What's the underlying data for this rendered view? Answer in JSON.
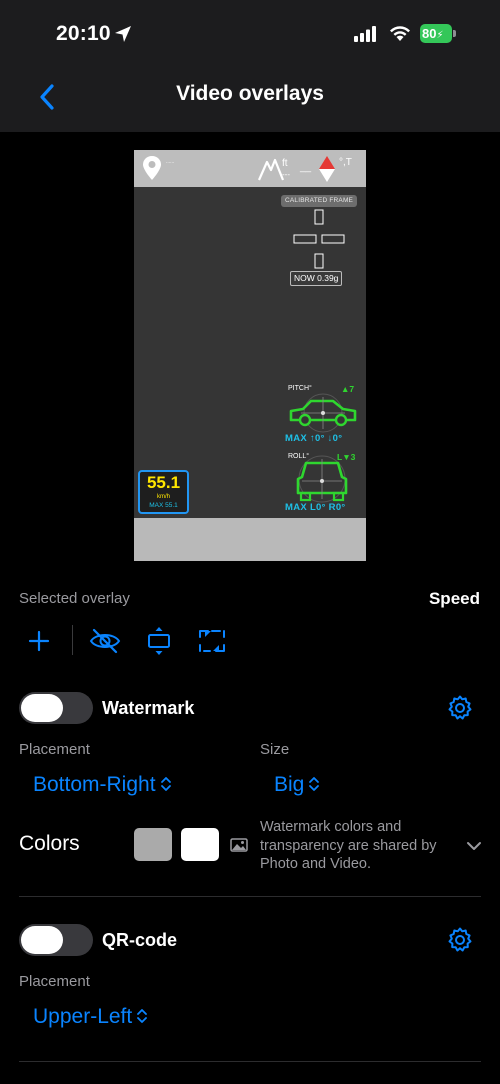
{
  "status_bar": {
    "time": "20:10",
    "battery": "80",
    "icons": [
      "location-arrow-icon",
      "cellular-signal-icon",
      "wifi-icon",
      "battery-charging-icon"
    ]
  },
  "nav": {
    "back_icon": "chevron-left-icon",
    "title": "Video overlays"
  },
  "preview": {
    "top_location_text": "......",
    "altitude_unit": "ft",
    "altitude_value": "---",
    "altitude_dash": "__",
    "heading_unit": "°,T",
    "calibrated_label": "CALIBRATED FRAME",
    "g_now": "NOW 0.39g",
    "pitch_label": "PITCH°",
    "pitch_value": "▲7",
    "pitch_max": "MAX ↑0° ↓0°",
    "roll_label": "ROLL°",
    "roll_value": "L▼3",
    "roll_max": "MAX L0° R0°",
    "speed_value": "55.1",
    "speed_unit": "km/h",
    "speed_max": "MAX 55.1"
  },
  "selected_overlay": {
    "label": "Selected overlay",
    "value": "Speed"
  },
  "toolbar": {
    "icons": [
      "plus-icon",
      "eye-slash-icon",
      "vertical-align-icon",
      "resize-frame-icon"
    ]
  },
  "watermark": {
    "title": "Watermark",
    "enabled": false,
    "placement_label": "Placement",
    "placement_value": "Bottom-Right",
    "size_label": "Size",
    "size_value": "Big",
    "colors_label": "Colors",
    "swatch_colors": [
      "#aaaaaa",
      "#ffffff"
    ],
    "note": "Watermark colors and transparency are shared by Photo and Video."
  },
  "qr_code": {
    "title": "QR-code",
    "enabled": false,
    "placement_label": "Placement",
    "placement_value": "Upper-Left"
  },
  "colors": {
    "accent": "#0a84ff",
    "background": "#000000",
    "bar": "#1c1c1e",
    "secondary_text": "#9a9a9f"
  }
}
